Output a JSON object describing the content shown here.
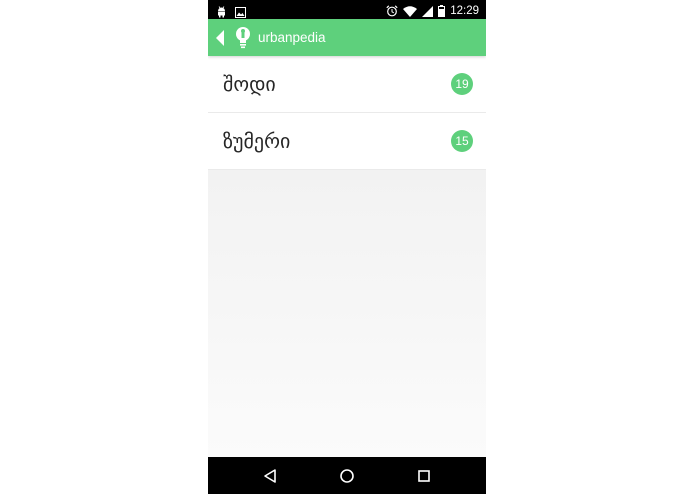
{
  "status_bar": {
    "time": "12:29",
    "left_icons": [
      "android-icon",
      "image-icon"
    ],
    "right_icons": [
      "alarm-icon",
      "wifi-icon",
      "signal-icon",
      "battery-icon"
    ]
  },
  "app_bar": {
    "title": "urbanpedia",
    "color": "#5ed07c"
  },
  "list": {
    "items": [
      {
        "label": "შოდი",
        "count": "19"
      },
      {
        "label": "ზუმერი",
        "count": "15"
      }
    ]
  },
  "nav_bar": {
    "buttons": [
      "back-icon",
      "home-icon",
      "recents-icon"
    ]
  }
}
